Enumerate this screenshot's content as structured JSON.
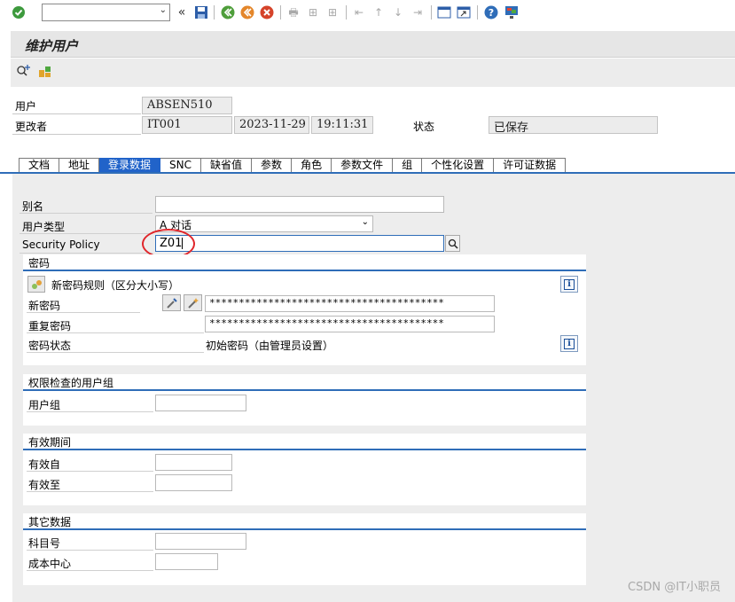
{
  "toolbar": {
    "command_value": "",
    "icons": [
      "check-icon",
      "back-double-icon",
      "save-icon",
      "back-icon",
      "exit-icon",
      "cancel-icon",
      "print-icon",
      "find-icon",
      "find-next-icon",
      "first-page-icon",
      "prev-page-icon",
      "next-page-icon",
      "last-page-icon",
      "create-session-icon",
      "shortcut-icon",
      "help-icon",
      "customize-icon"
    ]
  },
  "title": "维护用户",
  "header": {
    "user_label": "用户",
    "user_value": "ABSEN510",
    "changed_by_label": "更改者",
    "changed_by_value": "IT001",
    "date_value": "2023-11-29",
    "time_value": "19:11:31",
    "status_label": "状态",
    "status_value": "已保存"
  },
  "tabs": [
    "文档",
    "地址",
    "登录数据",
    "SNC",
    "缺省值",
    "参数",
    "角色",
    "参数文件",
    "组",
    "个性化设置",
    "许可证数据"
  ],
  "active_tab": "登录数据",
  "logon": {
    "alias_label": "别名",
    "alias_value": "",
    "user_type_label": "用户类型",
    "user_type_value": "A 对话",
    "security_policy_label": "Security Policy",
    "security_policy_value": "Z01"
  },
  "password": {
    "group_title": "密码",
    "rule_text": "新密码规则（区分大小写）",
    "new_pw_label": "新密码",
    "new_pw_value": "****************************************",
    "repeat_pw_label": "重复密码",
    "repeat_pw_value": "****************************************",
    "status_label": "密码状态",
    "status_value": "初始密码（由管理员设置）"
  },
  "user_group": {
    "group_title": "权限检查的用户组",
    "label": "用户组",
    "value": ""
  },
  "validity": {
    "group_title": "有效期间",
    "from_label": "有效自",
    "from_value": "",
    "to_label": "有效至",
    "to_value": ""
  },
  "other": {
    "group_title": "其它数据",
    "account_label": "科目号",
    "account_value": "",
    "cost_center_label": "成本中心",
    "cost_center_value": ""
  },
  "watermark": "CSDN @IT小职员",
  "colors": {
    "accent": "#2f6db8",
    "active_tab": "#2163c9",
    "highlight": "#e0262b"
  }
}
